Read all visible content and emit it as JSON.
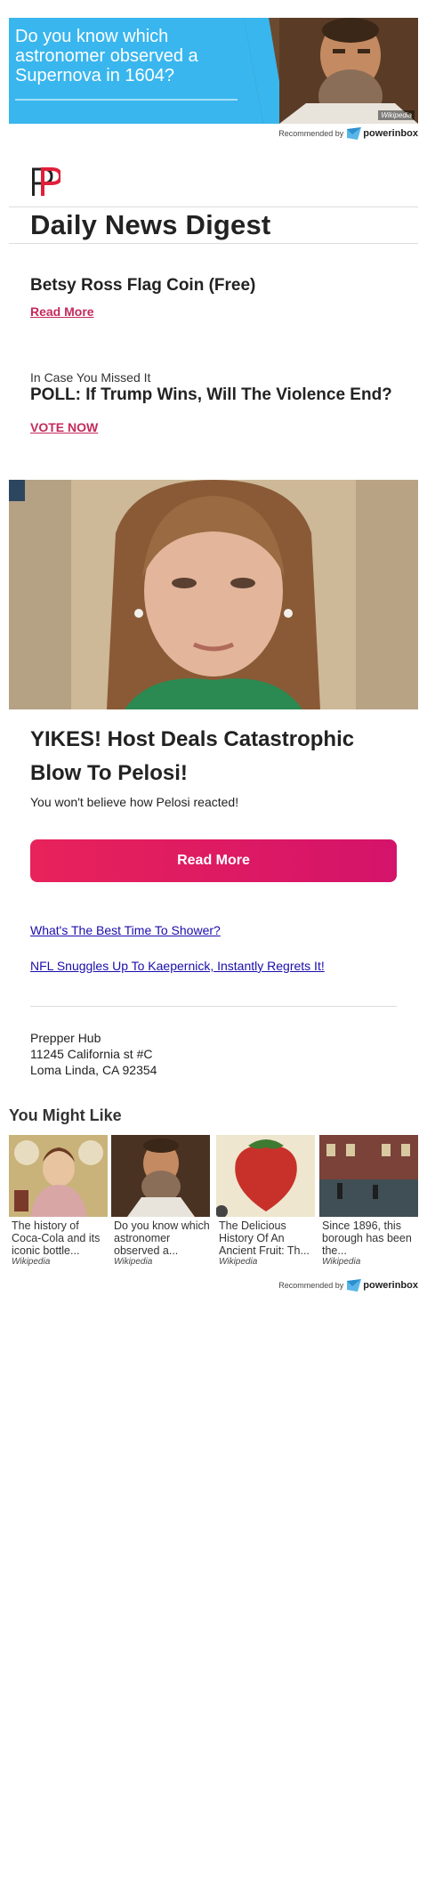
{
  "ad_top": {
    "text": "Do you know which astronomer observed a Supernova in 1604?",
    "source": "Wikipedia"
  },
  "recommended": {
    "label": "Recommended by",
    "brand": "powerinbox"
  },
  "header": {
    "title": "Daily News Digest"
  },
  "story1": {
    "title": "Betsy Ross Flag Coin (Free)",
    "link": "Read More"
  },
  "story2": {
    "kicker": "In Case You Missed It",
    "title": "POLL: If Trump Wins, Will The Violence End?",
    "link": "VOTE NOW"
  },
  "feature": {
    "headline": "YIKES! Host Deals Catastrophic Blow To Pelosi!",
    "subline": "You won't believe how Pelosi reacted!",
    "cta": "Read More"
  },
  "links": [
    "What's The Best Time To Shower?",
    "NFL Snuggles Up To Kaepernick, Instantly Regrets It!"
  ],
  "footer": {
    "name": "Prepper Hub",
    "street": "11245 California st #C",
    "city": "Loma Linda, CA 92354"
  },
  "you_might_like": {
    "title": "You Might Like",
    "cards": [
      {
        "text": "The history of Coca-Cola and its iconic bottle...",
        "source": "Wikipedia"
      },
      {
        "text": "Do you know which astronomer observed a...",
        "source": "Wikipedia"
      },
      {
        "text": "The Delicious History Of An Ancient Fruit: Th...",
        "source": "Wikipedia"
      },
      {
        "text": "Since 1896, this borough has been the...",
        "source": "Wikipedia"
      }
    ]
  },
  "colors": {
    "accent": "#c42a5c",
    "cta": "#e8225a",
    "ad_blue": "#39b6ee",
    "link": "#1a0dab"
  }
}
